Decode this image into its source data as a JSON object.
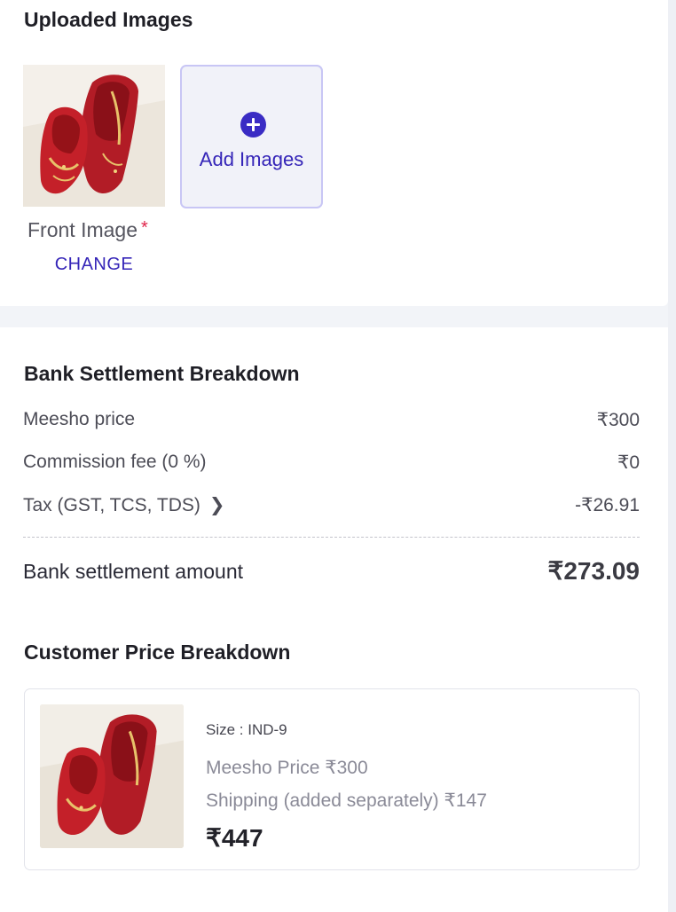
{
  "uploaded": {
    "title": "Uploaded Images",
    "add_images_label": "Add Images",
    "front_image_label": "Front Image",
    "required_mark": "*",
    "change_label": "CHANGE"
  },
  "bank": {
    "title": "Bank Settlement Breakdown",
    "rows": [
      {
        "label": "Meesho price",
        "value": "₹300"
      },
      {
        "label": "Commission fee (0 %)",
        "value": "₹0"
      },
      {
        "label": "Tax (GST, TCS, TDS)",
        "value": "-₹26.91"
      }
    ],
    "total_label": "Bank settlement amount",
    "total_value": "₹273.09"
  },
  "customer": {
    "title": "Customer Price Breakdown",
    "size_text": "Size : IND-9",
    "meesho_price_text": "Meesho Price ₹300",
    "shipping_text": "Shipping (added separately) ₹147",
    "total": "₹447"
  },
  "icons": {
    "add": "plus-circle-icon",
    "tax_expand": "chevron-right-icon"
  },
  "colors": {
    "accent": "#3525b8",
    "required": "#e0244a",
    "page_bg": "#f2f4f8"
  }
}
